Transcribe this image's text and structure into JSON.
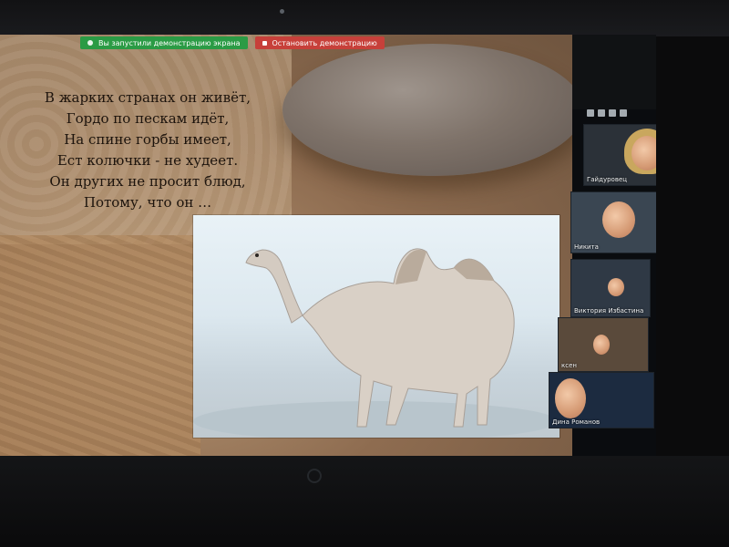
{
  "sharing_banner": {
    "status_text": "Вы запустили демонстрацию экрана",
    "stop_text": "Остановить демонстрацию"
  },
  "slide": {
    "poem_lines": [
      "В  жарких  странах  он  живёт,",
      "Гордо  по  пескам  идёт,",
      "На  спине  горбы  имеет,",
      "Ест  колючки  - не худеет.",
      "Он  других  не  просит  блюд,",
      "Потому,  что он  …"
    ]
  },
  "participants": [
    {
      "name": "Гайдуровец"
    },
    {
      "name": "Никита"
    },
    {
      "name": "Виктория Избастина"
    },
    {
      "name": "ксен"
    },
    {
      "name": "Дина Романов"
    }
  ],
  "icons": {
    "share": "screen-share-icon",
    "stop": "stop-icon",
    "panel": "panel-toggle-icon"
  },
  "colors": {
    "banner_green": "#2b9b45",
    "banner_red": "#c7403a",
    "panel_bg": "#0a0c0f"
  }
}
